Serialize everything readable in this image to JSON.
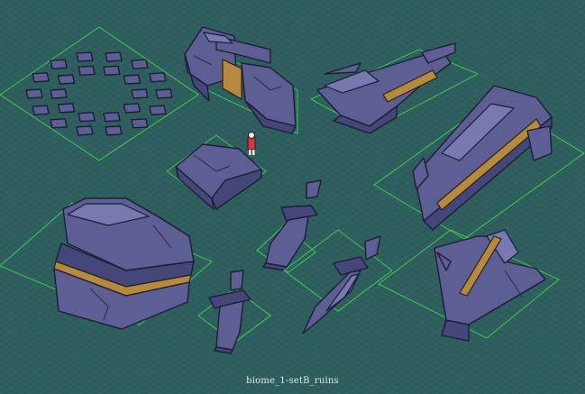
{
  "caption": "biome_1-setB_ruins",
  "colors": {
    "background": "#2d5c5c",
    "grid_line": "#3a6b6b",
    "tile_outline": "#3fd64a",
    "stone": "#5d5e93",
    "stone_shadow": "#45467a",
    "stone_highlight": "#767ab0",
    "gold_trim": "#b58a3e",
    "hero_red": "#d8383a"
  },
  "assets": [
    {
      "name": "stone-ring"
    },
    {
      "name": "ruined-gate"
    },
    {
      "name": "fallen-pillar-top"
    },
    {
      "name": "stone-slab-with-hero"
    },
    {
      "name": "fallen-pillar-long"
    },
    {
      "name": "large-block"
    },
    {
      "name": "stone-sword-upper"
    },
    {
      "name": "stone-sword-middle"
    },
    {
      "name": "stone-sword-lower"
    },
    {
      "name": "leaning-pillar"
    }
  ]
}
